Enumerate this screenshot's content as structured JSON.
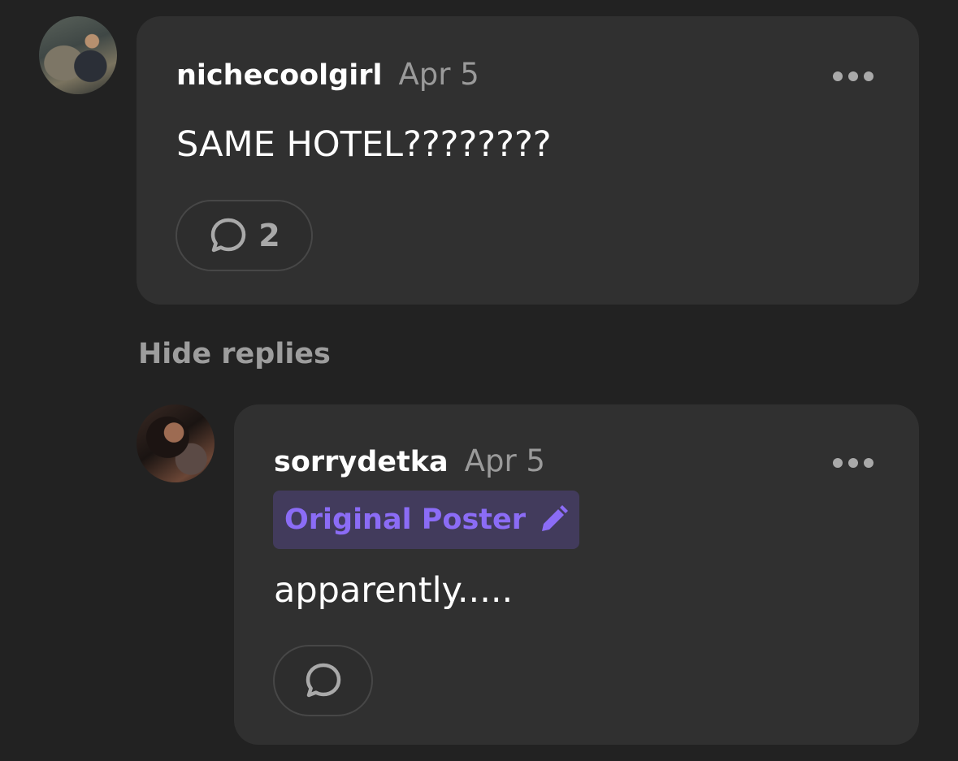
{
  "comments": [
    {
      "username": "nichecoolgirl",
      "date": "Apr 5",
      "text": "SAME HOTEL????????",
      "reply_count": "2"
    }
  ],
  "hide_replies_label": "Hide replies",
  "replies": [
    {
      "username": "sorrydetka",
      "date": "Apr 5",
      "badge": "Original Poster",
      "text": "apparently.....",
      "reply_count": ""
    }
  ],
  "colors": {
    "background": "#222222",
    "card": "#303030",
    "badge_background": "#423b5c",
    "badge_text": "#8b6cf6",
    "muted_text": "#9a9a9a"
  },
  "icons": {
    "more": "more-horizontal-icon",
    "reply": "speech-bubble-icon",
    "badge": "pencil-icon"
  }
}
